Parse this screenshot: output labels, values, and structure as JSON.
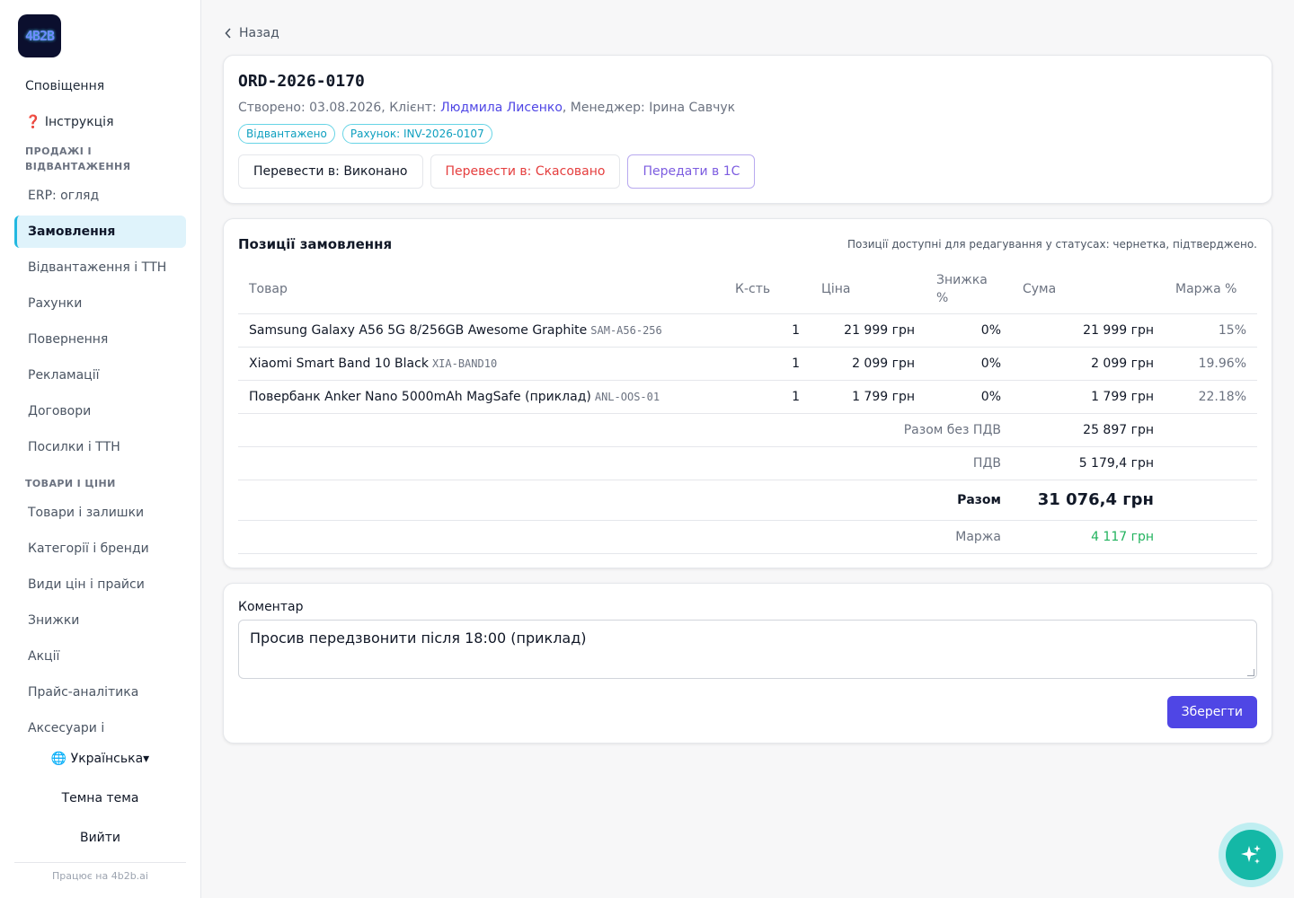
{
  "sidebar": {
    "logo_text": "4B2B",
    "notifications": "Сповіщення",
    "instructions": "❓ Інструкція",
    "section_sales": "ПРОДАЖІ І ВІДВАНТАЖЕННЯ",
    "sales_items": [
      "ERP: огляд",
      "Замовлення",
      "Відвантаження і ТТН",
      "Рахунки",
      "Повернення",
      "Рекламації",
      "Договори",
      "Посилки і ТТН"
    ],
    "section_goods": "ТОВАРИ І ЦІНИ",
    "goods_items": [
      "Товари і залишки",
      "Категорії і бренди",
      "Види цін і прайси",
      "Знижки",
      "Акції",
      "Прайс-аналітика",
      "Аксесуари і"
    ],
    "language": "🌐 Українська▾",
    "theme": "Темна тема",
    "logout": "Вийти",
    "powered": "Працює на 4b2b.ai"
  },
  "back_label": "Назад",
  "order": {
    "id": "ORD-2026-0170",
    "created_prefix": "Створено: 03.08.2026, Клієнт: ",
    "client": "Людмила Лисенко",
    "manager_text": ", Менеджер: Ірина Савчук",
    "badges": [
      "Відвантажено",
      "Рахунок: INV-2026-0107"
    ],
    "actions": {
      "complete": "Перевести в: Виконано",
      "cancel": "Перевести в: Скасовано",
      "send_1c": "Передати в 1С"
    }
  },
  "items_card": {
    "title": "Позиції замовлення",
    "note": "Позиції доступні для редагування у статусах: чернетка, підтверджено.",
    "columns": [
      "Товар",
      "К-сть",
      "Ціна",
      "Знижка %",
      "Сума",
      "Маржа %"
    ],
    "rows": [
      {
        "name": "Samsung Galaxy A56 5G 8/256GB Awesome Graphite",
        "sku": "SAM-A56-256",
        "qty": "1",
        "price": "21 999 грн",
        "discount": "0%",
        "sum": "21 999 грн",
        "margin": "15%"
      },
      {
        "name": "Xiaomi Smart Band 10 Black",
        "sku": "XIA-BAND10",
        "qty": "1",
        "price": "2 099 грн",
        "discount": "0%",
        "sum": "2 099 грн",
        "margin": "19.96%"
      },
      {
        "name": "Повербанк Anker Nano 5000mAh MagSafe (приклад)",
        "sku": "ANL-OOS-01",
        "qty": "1",
        "price": "1 799 грн",
        "discount": "0%",
        "sum": "1 799 грн",
        "margin": "22.18%"
      }
    ],
    "totals": {
      "subtotal_label": "Разом без ПДВ",
      "subtotal": "25 897 грн",
      "vat_label": "ПДВ",
      "vat": "5 179,4 грн",
      "total_label": "Разом",
      "total": "31 076,4 грн",
      "margin_label": "Маржа",
      "margin": "4 117 грн"
    }
  },
  "comment": {
    "label": "Коментар",
    "value": "Просив передзвонити після 18:00 (приклад)",
    "save": "Зберегти"
  },
  "colors": {
    "accent": "#4f46e5",
    "teal": "#14b8a6",
    "active_bg": "#dff3fb",
    "margin_green": "#22b35e"
  }
}
